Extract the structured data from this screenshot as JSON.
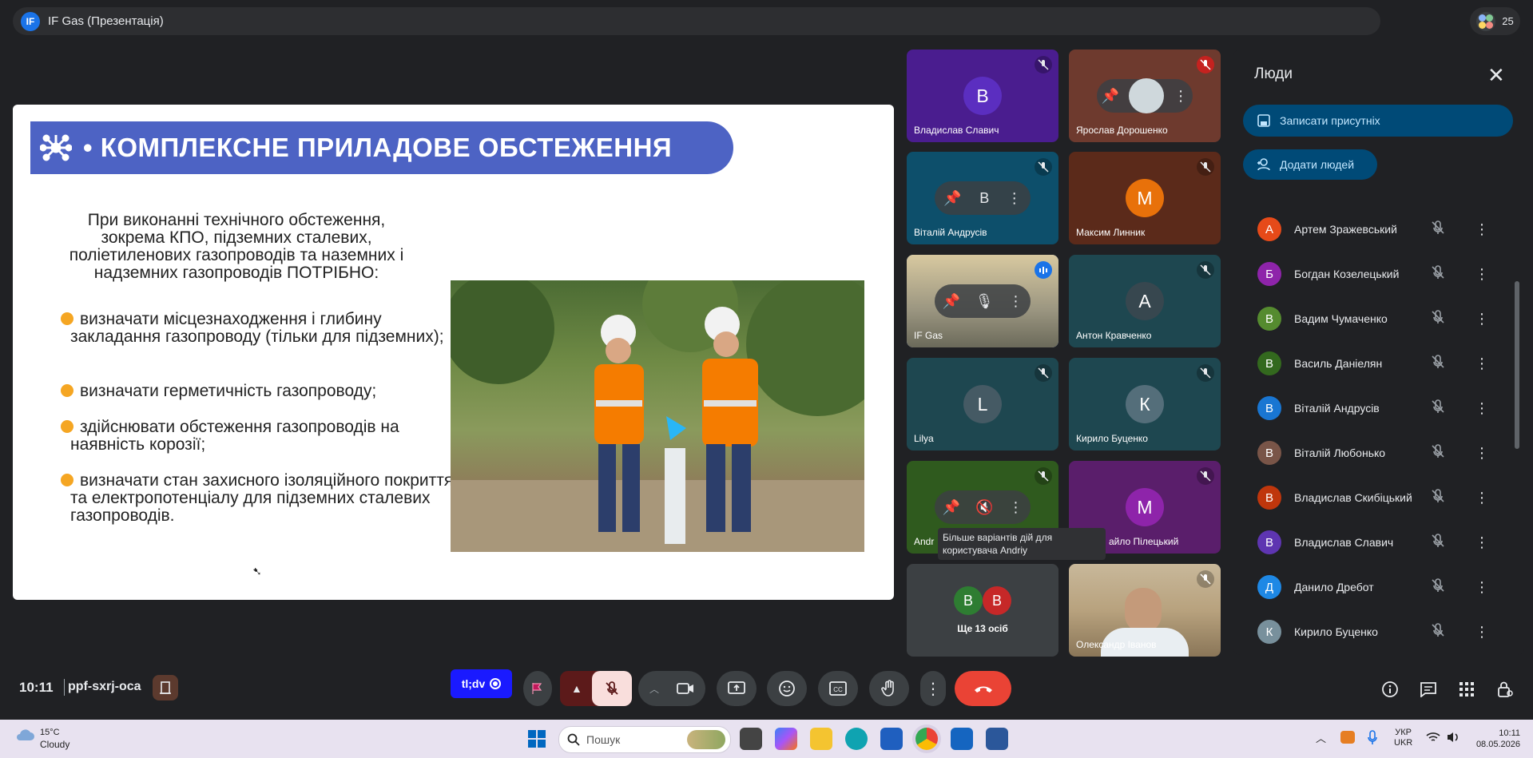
{
  "meeting": {
    "badge": "IF",
    "title": "IF Gas (Презентація)",
    "participant_count": "25",
    "time": "10:11",
    "code": "ppf-sxrj-oca"
  },
  "slide": {
    "title": "• КОМПЛЕКСНЕ ПРИЛАДОВЕ ОБСТЕЖЕННЯ",
    "intro": "При виконанні технічного обстеження, зокрема КПО, підземних сталевих, поліетиленових газопроводів та наземних і надземних газопроводів ПОТРІБНО:",
    "bullets": [
      "визначати місцезнаходження і глибину закладання газопроводу (тільки для підземних);",
      "визначати герметичність газопроводу;",
      "здійснювати обстеження газопроводів на наявність корозії;",
      "визначати стан захисного ізоляційного покриття та електропотенціалу для підземних сталевих газопроводів."
    ]
  },
  "tiles": [
    {
      "name": "Владислав Славич",
      "initial": "В",
      "bg": "#4a1d8f",
      "avatar_color": "#5b2ec0"
    },
    {
      "name": "Ярослав Дорошенко",
      "initial": "",
      "bg": "#6e3a2e",
      "avatar_color": "#8a6a5a"
    },
    {
      "name": "Віталій Андрусів",
      "initial": "В",
      "bg": "#0d4f6b",
      "avatar_color": "#1565c0"
    },
    {
      "name": "Максим Линник",
      "initial": "М",
      "bg": "#5b2a1a",
      "avatar_color": "#e8710a"
    },
    {
      "name": "IF Gas",
      "initial": "",
      "bg": "#7a7560",
      "avatar_color": "#555"
    },
    {
      "name": "Антон Кравченко",
      "initial": "А",
      "bg": "#1e4750",
      "avatar_color": "#37474f"
    },
    {
      "name": "Lilya",
      "initial": "L",
      "bg": "#1e4750",
      "avatar_color": "#455a64"
    },
    {
      "name": "Кирило Буценко",
      "initial": "К",
      "bg": "#1e4750",
      "avatar_color": "#546e7a"
    },
    {
      "name": "Andr",
      "initial": "",
      "bg": "#2f5a1e",
      "avatar_color": "#33691e"
    },
    {
      "name": "айло Пілецький",
      "initial": "М",
      "bg": "#5a1e6b",
      "avatar_color": "#8e24aa"
    },
    {
      "name": "Ще 13 осіб",
      "initials": [
        "В",
        "В"
      ],
      "bg": "#3c4043"
    },
    {
      "name": "Олександр Іванов",
      "initial": "",
      "bg": "#a89070",
      "avatar_color": "#a89070"
    }
  ],
  "tooltip": "Більше варіантів дій для користувача Andriy",
  "people": {
    "title": "Люди",
    "record_label": "Записати присутніх",
    "add_label": "Додати людей",
    "list": [
      {
        "initial": "А",
        "name": "Артем Зражевський",
        "color": "#e64a19"
      },
      {
        "initial": "Б",
        "name": "Богдан Козелецький",
        "color": "#8e24aa"
      },
      {
        "initial": "В",
        "name": "Вадим Чумаченко",
        "color": "#558b2f"
      },
      {
        "initial": "В",
        "name": "Василь Даніелян",
        "color": "#33691e"
      },
      {
        "initial": "В",
        "name": "Віталій Андрусів",
        "color": "#1976d2"
      },
      {
        "initial": "В",
        "name": "Віталій Любонько",
        "color": "#795548"
      },
      {
        "initial": "В",
        "name": "Владислав Скибіцький",
        "color": "#bf360c"
      },
      {
        "initial": "В",
        "name": "Владислав Славич",
        "color": "#5e35b1"
      },
      {
        "initial": "Д",
        "name": "Данило Дребот",
        "color": "#1e88e5"
      },
      {
        "initial": "К",
        "name": "Кирило Буценко",
        "color": "#78909c"
      }
    ]
  },
  "controls": {
    "extension_label": "tl;dv"
  },
  "taskbar": {
    "temp": "15°C",
    "weather": "Cloudy",
    "search_placeholder": "Пошук",
    "lang_top": "УКР",
    "lang_bottom": "UKR",
    "time": "10:11",
    "date": "08.05.2026"
  }
}
